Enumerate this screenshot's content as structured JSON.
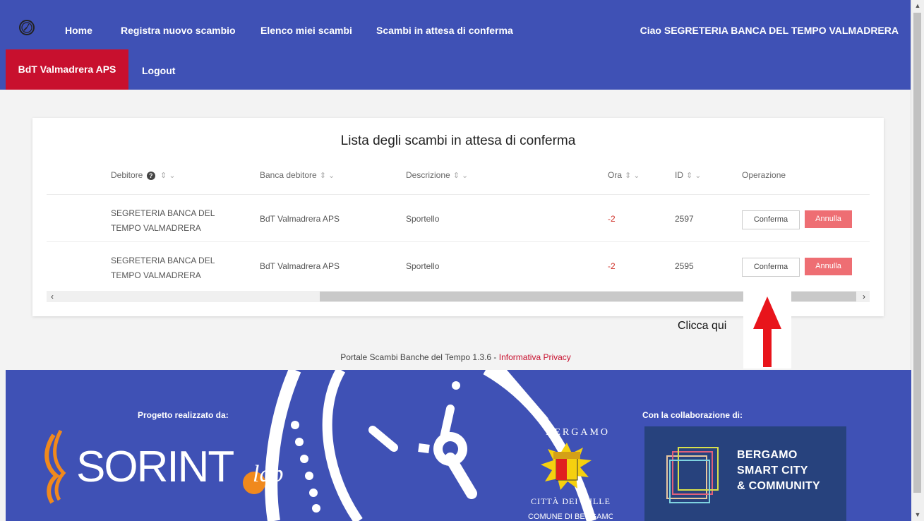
{
  "nav": {
    "home": "Home",
    "register": "Registra nuovo scambio",
    "my_exchanges": "Elenco miei scambi",
    "pending": "Scambi in attesa di conferma",
    "greeting": "Ciao SEGRETERIA BANCA DEL TEMPO VALMADRERA",
    "org": "BdT Valmadrera APS",
    "logout": "Logout"
  },
  "card": {
    "title": "Lista degli scambi in attesa di conferma",
    "headers": {
      "debtor": "Debitore",
      "bank": "Banca debitore",
      "description": "Descrizione",
      "hours": "Ora",
      "id": "ID",
      "operation": "Operazione"
    },
    "rows": [
      {
        "debtor": "SEGRETERIA BANCA DEL TEMPO VALMADRERA",
        "bank": "BdT Valmadrera APS",
        "description": "Sportello",
        "hours": "-2",
        "id": "2597",
        "confirm": "Conferma",
        "cancel": "Annulla"
      },
      {
        "debtor": "SEGRETERIA BANCA DEL TEMPO VALMADRERA",
        "bank": "BdT Valmadrera APS",
        "description": "Sportello",
        "hours": "-2",
        "id": "2595",
        "confirm": "Conferma",
        "cancel": "Annulla"
      }
    ]
  },
  "annotation": {
    "text": "Clicca qui",
    "color": "#e8141b"
  },
  "footer": {
    "version_text": "Portale Scambi Banche del Tempo 1.3.6 - ",
    "privacy_link": "Informativa Privacy",
    "project_by": "Progetto realizzato da:",
    "collaboration": "Con la collaborazione di:",
    "sorint_logo_text": "SORINT",
    "sorint_lab": "lab",
    "crest_top": "BERGAMO",
    "crest_bottom": "CITTÀ DEI MILLE",
    "crest_under": "COMUNE DI BERGAMO",
    "bsc_line1": "BERGAMO",
    "bsc_line2": "SMART CITY",
    "bsc_line3": "& COMMUNITY"
  },
  "colors": {
    "primary": "#3f51b5",
    "accent": "#c8102e",
    "cancel_button": "#ee6e73"
  }
}
